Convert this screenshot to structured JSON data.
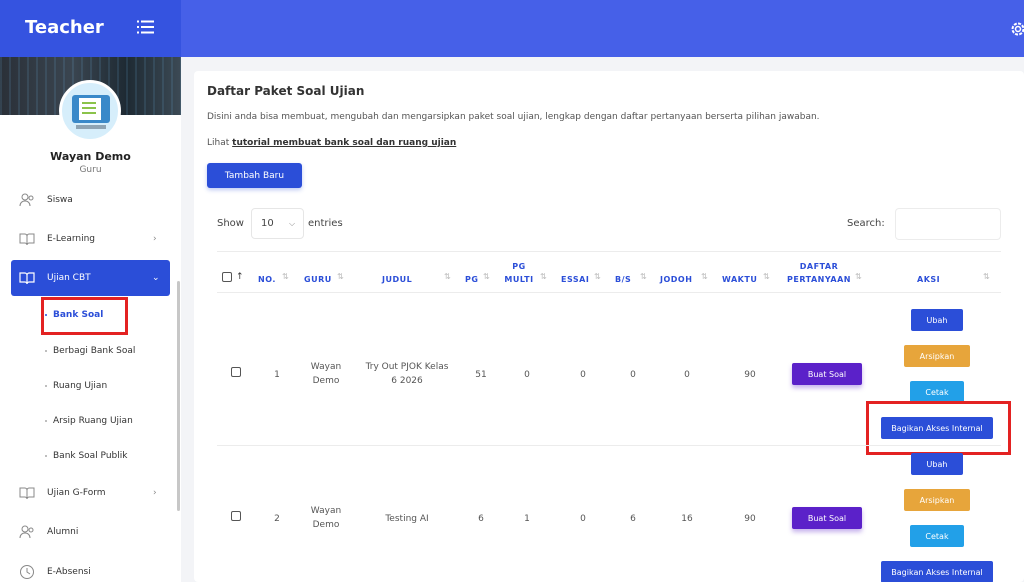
{
  "header": {
    "brand": "Teacher",
    "menu_icon": "menu-icon",
    "settings_icon": "gear-icon"
  },
  "profile": {
    "name": "Wayan Demo",
    "role": "Guru"
  },
  "sidebar": {
    "items": [
      {
        "label": "Siswa",
        "icon": "users-icon"
      },
      {
        "label": "E-Learning",
        "icon": "book-icon",
        "chevron": "›"
      },
      {
        "label": "Ujian CBT",
        "icon": "book-icon",
        "chevron": "⌄",
        "active": true
      },
      {
        "label": "Ujian G-Form",
        "icon": "book-icon",
        "chevron": "›"
      },
      {
        "label": "Alumni",
        "icon": "users-icon"
      },
      {
        "label": "E-Absensi",
        "icon": "clock-icon"
      }
    ],
    "sub_items": [
      "Bank Soal",
      "Berbagi Bank Soal",
      "Ruang Ujian",
      "Arsip Ruang Ujian",
      "Bank Soal Publik"
    ]
  },
  "main": {
    "title": "Daftar Paket Soal Ujian",
    "description": "Disini anda bisa membuat, mengubah dan mengarsipkan paket soal ujian, lengkap dengan daftar pertanyaan berserta pilihan jawaban.",
    "link_prefix": "Lihat",
    "link_text": "tutorial membuat bank soal dan ruang ujian",
    "add_button": "Tambah Baru",
    "show_label": "Show",
    "show_value": "10",
    "entries_label": "entries",
    "search_label": "Search:"
  },
  "table": {
    "columns": {
      "no": "NO.",
      "guru": "GURU",
      "judul": "JUDUL",
      "pg": "PG",
      "pg_multi_1": "PG",
      "pg_multi_2": "MULTI",
      "essai": "ESSAI",
      "bs": "B/S",
      "jodoh": "JODOH",
      "waktu": "WAKTU",
      "daftar_1": "DAFTAR",
      "daftar_2": "PERTANYAAN",
      "aksi": "AKSI"
    },
    "rows": [
      {
        "no": "1",
        "guru_1": "Wayan",
        "guru_2": "Demo",
        "judul_1": "Try Out PJOK Kelas",
        "judul_2": "6 2026",
        "pg": "51",
        "pg_multi": "0",
        "essai": "0",
        "bs": "0",
        "jodoh": "0",
        "waktu": "90"
      },
      {
        "no": "2",
        "guru_1": "Wayan",
        "guru_2": "Demo",
        "judul_1": "Testing AI",
        "judul_2": "",
        "pg": "6",
        "pg_multi": "1",
        "essai": "0",
        "bs": "6",
        "jodoh": "16",
        "waktu": "90"
      }
    ],
    "actions": {
      "buat_soal": "Buat Soal",
      "ubah": "Ubah",
      "arsipkan": "Arsipkan",
      "cetak": "Cetak",
      "bagikan": "Bagikan Akses Internal"
    }
  },
  "colors": {
    "primary": "#2b4ed8",
    "topbar": "#4660e8",
    "purple": "#5b21c9",
    "orange": "#e7a53b",
    "lightblue": "#22a0e8",
    "highlight": "#e32222"
  }
}
